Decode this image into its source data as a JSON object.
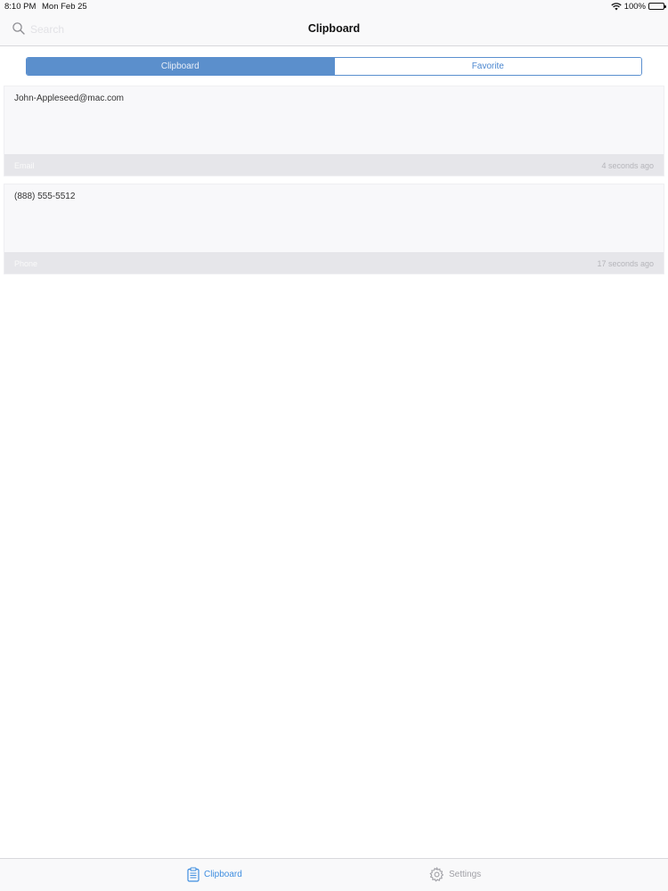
{
  "status_bar": {
    "time": "8:10 PM",
    "date": "Mon Feb 25",
    "battery": "100%"
  },
  "nav": {
    "title": "Clipboard",
    "search_placeholder": "Search"
  },
  "segments": [
    {
      "label": "Clipboard",
      "active": true
    },
    {
      "label": "Favorite",
      "active": false
    }
  ],
  "clips": [
    {
      "text": "John-Appleseed@mac.com",
      "type": "Email",
      "time": "4 seconds ago"
    },
    {
      "text": "(888) 555-5512",
      "type": "Phone",
      "time": "17 seconds ago"
    }
  ],
  "tabs": [
    {
      "label": "Clipboard",
      "icon": "clipboard-icon",
      "active": true
    },
    {
      "label": "Settings",
      "icon": "gear-icon",
      "active": false
    }
  ],
  "colors": {
    "accent": "#3f8ee0",
    "segment_active": "#5b8fcc",
    "inactive": "#a0a0a6"
  }
}
